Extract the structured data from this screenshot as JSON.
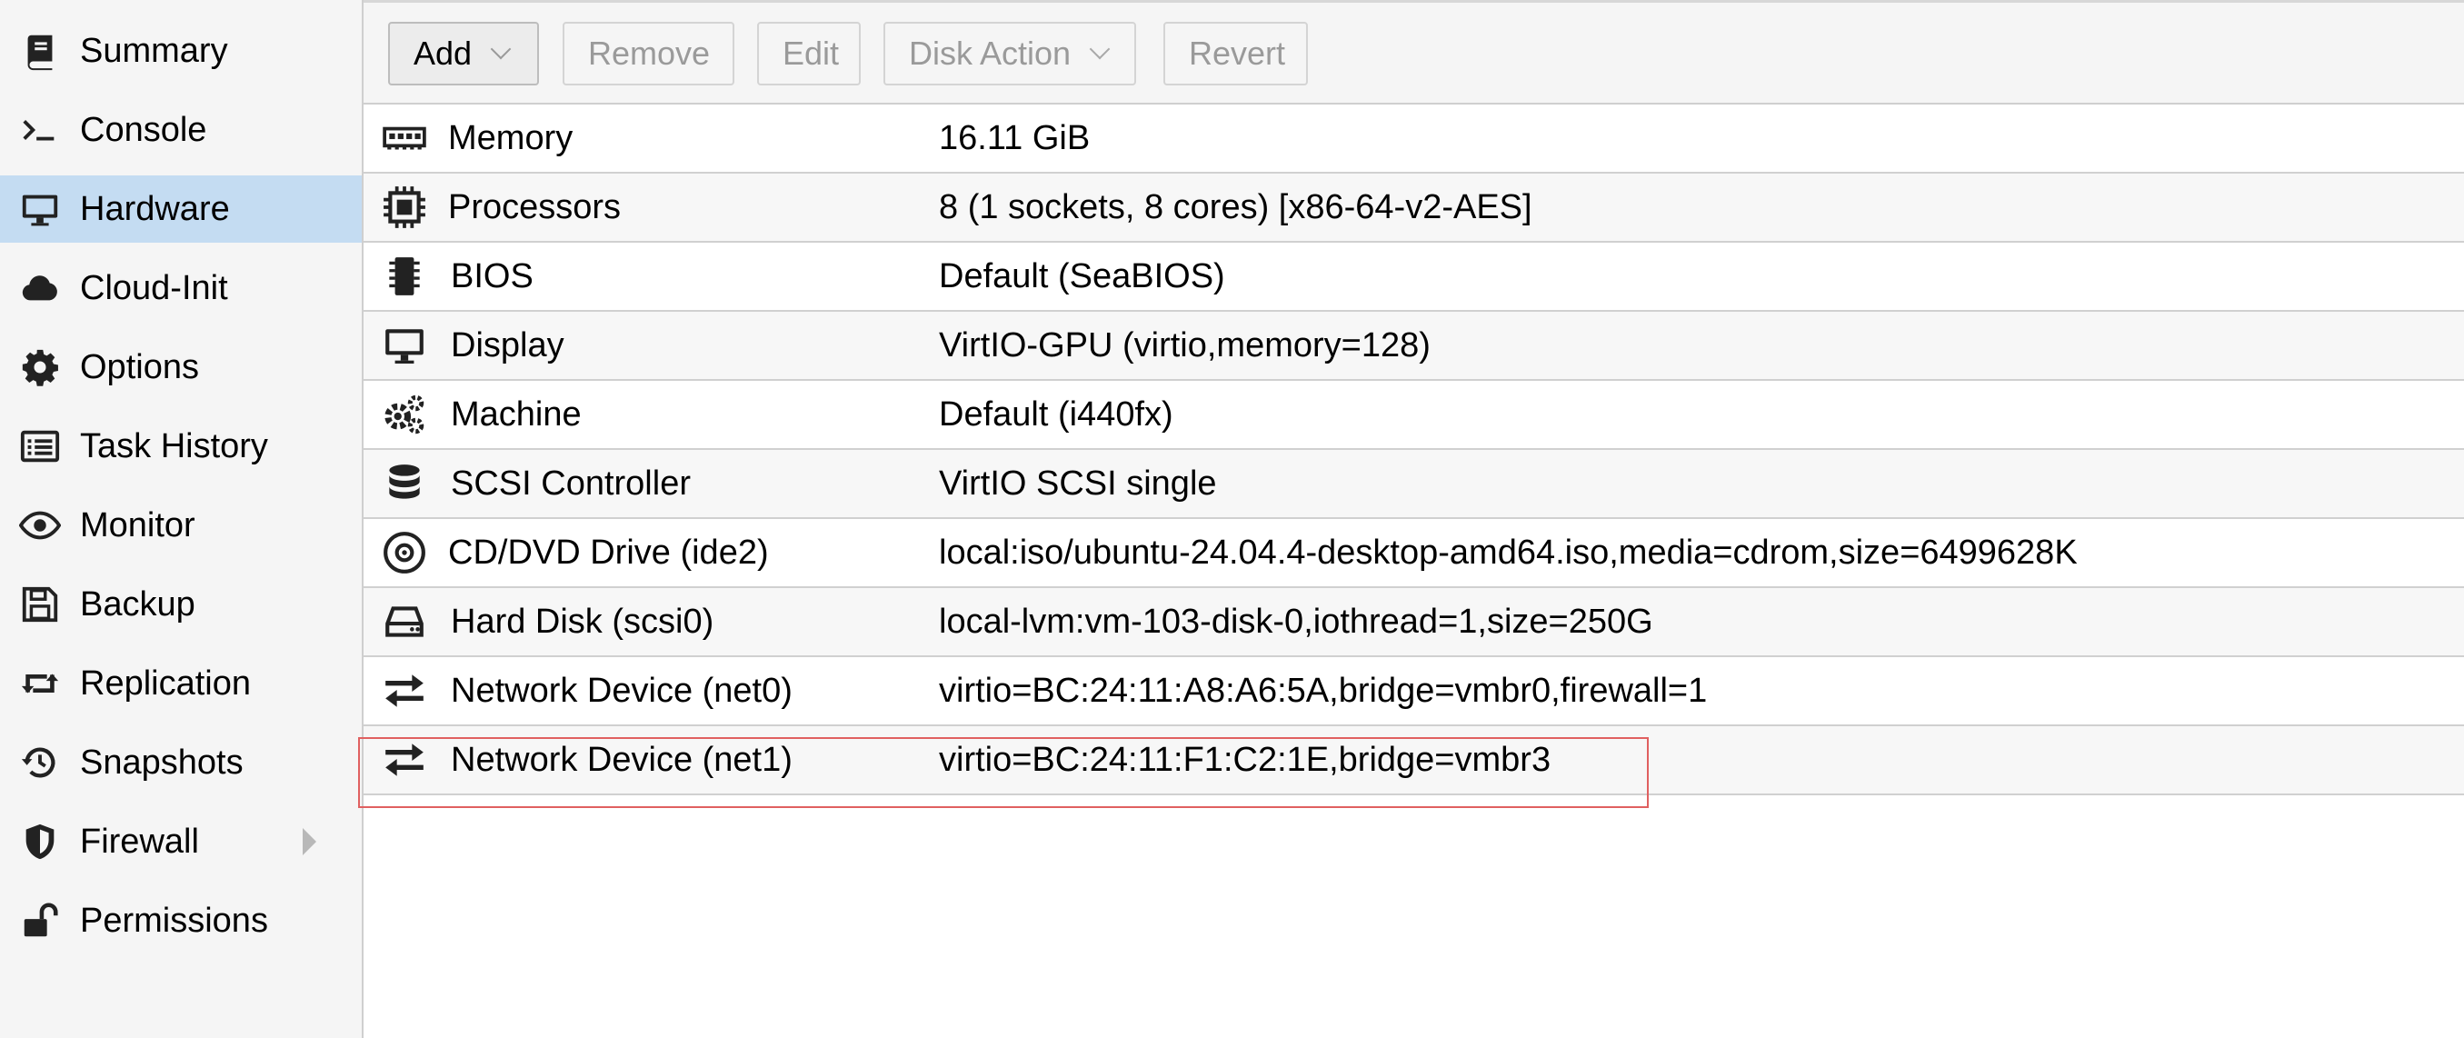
{
  "sidebar": {
    "items": [
      {
        "label": "Summary",
        "icon": "book-icon",
        "active": false
      },
      {
        "label": "Console",
        "icon": "terminal-icon",
        "active": false
      },
      {
        "label": "Hardware",
        "icon": "desktop-icon",
        "active": true
      },
      {
        "label": "Cloud-Init",
        "icon": "cloud-icon",
        "active": false
      },
      {
        "label": "Options",
        "icon": "gear-icon",
        "active": false
      },
      {
        "label": "Task History",
        "icon": "list-icon",
        "active": false
      },
      {
        "label": "Monitor",
        "icon": "eye-icon",
        "active": false
      },
      {
        "label": "Backup",
        "icon": "floppy-icon",
        "active": false
      },
      {
        "label": "Replication",
        "icon": "retweet-icon",
        "active": false
      },
      {
        "label": "Snapshots",
        "icon": "history-icon",
        "active": false
      },
      {
        "label": "Firewall",
        "icon": "shield-icon",
        "active": false,
        "expandable": true
      },
      {
        "label": "Permissions",
        "icon": "unlock-icon",
        "active": false
      }
    ]
  },
  "toolbar": {
    "add_label": "Add",
    "remove_label": "Remove",
    "edit_label": "Edit",
    "disk_action_label": "Disk Action",
    "revert_label": "Revert"
  },
  "hardware": {
    "rows": [
      {
        "name": "Memory",
        "value": "16.11 GiB",
        "icon": "memory-icon"
      },
      {
        "name": "Processors",
        "value": "8 (1 sockets, 8 cores) [x86-64-v2-AES]",
        "icon": "cpu-icon"
      },
      {
        "name": "BIOS",
        "value": "Default (SeaBIOS)",
        "icon": "chip-icon"
      },
      {
        "name": "Display",
        "value": "VirtIO-GPU (virtio,memory=128)",
        "icon": "desktop-icon"
      },
      {
        "name": "Machine",
        "value": "Default (i440fx)",
        "icon": "cogs-icon"
      },
      {
        "name": "SCSI Controller",
        "value": "VirtIO SCSI single",
        "icon": "database-icon"
      },
      {
        "name": "CD/DVD Drive (ide2)",
        "value": "local:iso/ubuntu-24.04.4-desktop-amd64.iso,media=cdrom,size=6499628K",
        "icon": "cdrom-icon"
      },
      {
        "name": "Hard Disk (scsi0)",
        "value": "local-lvm:vm-103-disk-0,iothread=1,size=250G",
        "icon": "hdd-icon"
      },
      {
        "name": "Network Device (net0)",
        "value": "virtio=BC:24:11:A8:A6:5A,bridge=vmbr0,firewall=1",
        "icon": "exchange-icon"
      },
      {
        "name": "Network Device (net1)",
        "value": "virtio=BC:24:11:F1:C2:1E,bridge=vmbr3",
        "icon": "exchange-icon"
      }
    ]
  },
  "colors": {
    "active_nav": "#c4dcf2",
    "highlight_border": "#e06060"
  }
}
